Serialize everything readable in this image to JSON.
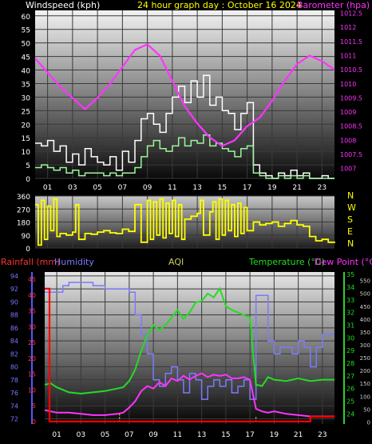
{
  "chart_data": [
    {
      "type": "line",
      "panel": "wind-barometer",
      "title": "24 hour graph day : October 16 2024",
      "left_label": "Windspeed (kph)",
      "right_label": "Barometer (hpa)",
      "x_ticks": [
        "01",
        "03",
        "05",
        "07",
        "09",
        "11",
        "13",
        "15",
        "17",
        "19",
        "21",
        "23"
      ],
      "y_left_ticks": [
        "0",
        "5",
        "10",
        "15",
        "20",
        "25",
        "30",
        "35",
        "40",
        "45",
        "50",
        "55",
        "60"
      ],
      "y_left_range": [
        0,
        62
      ],
      "y_right_ticks": [
        "1007",
        "1007.5",
        "1008",
        "1008.5",
        "1009",
        "1009.5",
        "1010",
        "1010.5",
        "1011",
        "1011.5",
        "1012",
        "1012.5"
      ],
      "y_right_range": [
        1006.65,
        1012.6
      ],
      "series": [
        {
          "name": "Windspeed gust",
          "color": "#ffffff",
          "x": [
            0,
            0.5,
            1,
            1.5,
            2,
            2.5,
            3,
            3.5,
            4,
            4.5,
            5,
            5.5,
            6,
            6.5,
            7,
            7.5,
            8,
            8.5,
            9,
            9.5,
            10,
            10.5,
            11,
            11.5,
            12,
            12.5,
            13,
            13.5,
            14,
            14.5,
            15,
            15.5,
            16,
            16.5,
            17,
            17.5,
            18,
            18.5,
            19,
            19.5,
            20,
            20.5,
            21,
            21.5,
            22,
            22.5,
            23,
            23.5,
            24
          ],
          "values": [
            13,
            12,
            14,
            10,
            12,
            6,
            9,
            5,
            11,
            8,
            6,
            5,
            8,
            3,
            10,
            6,
            14,
            22,
            24,
            20,
            17,
            24,
            30,
            34,
            28,
            36,
            30,
            38,
            27,
            30,
            25,
            24,
            18,
            24,
            28,
            5,
            2,
            1,
            0,
            2,
            1,
            3,
            1,
            2,
            0,
            0,
            1,
            0,
            0
          ]
        },
        {
          "name": "Windspeed average",
          "color": "#9cf59c",
          "x": [
            0,
            0.5,
            1,
            1.5,
            2,
            2.5,
            3,
            3.5,
            4,
            4.5,
            5,
            5.5,
            6,
            6.5,
            7,
            7.5,
            8,
            8.5,
            9,
            9.5,
            10,
            10.5,
            11,
            11.5,
            12,
            12.5,
            13,
            13.5,
            14,
            14.5,
            15,
            15.5,
            16,
            16.5,
            17,
            17.5,
            18,
            18.5,
            19,
            19.5,
            20,
            20.5,
            21,
            21.5,
            22,
            22.5,
            23,
            23.5,
            24
          ],
          "values": [
            4,
            5,
            4,
            3,
            4,
            2,
            3,
            1,
            2,
            2,
            2,
            1,
            2,
            1,
            2,
            2,
            4,
            8,
            12,
            14,
            11,
            10,
            12,
            15,
            12,
            14,
            13,
            16,
            12,
            13,
            11,
            10,
            8,
            11,
            12,
            2,
            1,
            0,
            0,
            1,
            0,
            1,
            0,
            1,
            0,
            0,
            0,
            0,
            0
          ]
        },
        {
          "name": "Barometer",
          "color": "#ff33ff",
          "x": [
            0,
            1,
            2,
            3,
            4,
            5,
            6,
            7,
            8,
            9,
            10,
            11,
            12,
            13,
            14,
            15,
            16,
            17,
            18,
            19,
            20,
            21,
            22,
            23,
            24
          ],
          "values": [
            1010.9,
            1010.4,
            1009.9,
            1009.5,
            1009.1,
            1009.5,
            1010.0,
            1010.6,
            1011.2,
            1011.4,
            1011.0,
            1010.1,
            1009.2,
            1008.6,
            1008.1,
            1007.8,
            1008.0,
            1008.5,
            1008.8,
            1009.4,
            1010.1,
            1010.7,
            1011.0,
            1010.8,
            1010.5
          ]
        }
      ]
    },
    {
      "type": "line",
      "panel": "wind-direction",
      "y_left_ticks": [
        "0",
        "90",
        "180",
        "270",
        "360"
      ],
      "y_range": [
        0,
        360
      ],
      "right_labels": [
        "N",
        "W",
        "S",
        "E",
        "N"
      ],
      "series": [
        {
          "name": "Wind direction",
          "color": "#ffff00",
          "x": [
            0,
            0.25,
            0.5,
            0.75,
            1,
            1.25,
            1.5,
            1.75,
            2,
            2.5,
            3,
            3.25,
            3.5,
            4,
            4.5,
            5,
            5.5,
            6,
            6.5,
            7,
            7.5,
            8,
            8.5,
            9,
            9.25,
            9.5,
            9.75,
            10,
            10.25,
            10.5,
            10.75,
            11,
            11.25,
            11.5,
            11.75,
            12,
            12.5,
            13,
            13.25,
            13.5,
            14,
            14.25,
            14.5,
            14.75,
            15,
            15.25,
            15.5,
            15.75,
            16,
            16.25,
            16.5,
            16.75,
            17,
            17.5,
            18,
            18.5,
            19,
            19.5,
            20,
            20.5,
            21,
            21.5,
            22,
            22.5,
            23,
            23.5,
            24
          ],
          "values": [
            300,
            20,
            330,
            60,
            290,
            120,
            340,
            80,
            100,
            90,
            110,
            300,
            60,
            100,
            95,
            110,
            120,
            105,
            100,
            130,
            115,
            300,
            40,
            330,
            60,
            320,
            90,
            340,
            70,
            310,
            100,
            330,
            80,
            300,
            60,
            200,
            220,
            240,
            330,
            90,
            250,
            320,
            60,
            340,
            90,
            330,
            120,
            300,
            80,
            310,
            100,
            280,
            120,
            180,
            160,
            170,
            180,
            150,
            170,
            190,
            160,
            150,
            80,
            50,
            60,
            40,
            45
          ]
        }
      ]
    },
    {
      "type": "line",
      "panel": "rain-humidity-temperature",
      "labels": {
        "rainfall": "Rainfall (mm)",
        "humidity": "Humidity",
        "aqi": "AQI",
        "temperature": "Temperature (°C)",
        "dew_point": "Dew Point (°C)"
      },
      "y_humidity_ticks": [
        "72",
        "74",
        "76",
        "78",
        "80",
        "82",
        "84",
        "86",
        "88",
        "90",
        "92",
        "94"
      ],
      "y_humidity_range": [
        71.2,
        94.6
      ],
      "y_rain_ticks": [
        "0",
        "5",
        "10",
        "15",
        "20",
        "25",
        "30",
        "35",
        "40",
        "45"
      ],
      "y_rain_range": [
        -0.8,
        47.3
      ],
      "y_temp_ticks": [
        "24",
        "25",
        "26",
        "27",
        "28",
        "29",
        "30",
        "31",
        "32",
        "33",
        "34",
        "35"
      ],
      "y_temp_range": [
        23.2,
        35.2
      ],
      "y_aqi_ticks": [
        "0",
        "50",
        "100",
        "150",
        "200",
        "250",
        "300",
        "350",
        "400",
        "450",
        "500",
        "550"
      ],
      "y_aqi_range": [
        -8,
        583
      ],
      "series": [
        {
          "name": "Rainfall",
          "color": "#ff0000",
          "x": [
            0,
            0.4,
            0.4,
            1,
            3,
            5,
            7,
            9,
            11,
            13,
            15,
            17,
            19,
            20,
            21,
            21.5,
            22,
            22,
            23,
            24
          ],
          "values": [
            42,
            42,
            0,
            0,
            0,
            0,
            0,
            0,
            0,
            0,
            0,
            0,
            0,
            0,
            0,
            0,
            0,
            1.5,
            1.5,
            1.5
          ]
        },
        {
          "name": "Humidity",
          "color": "#7a7aff",
          "x": [
            0,
            1,
            1.5,
            2,
            3,
            4,
            5,
            6,
            7,
            7.5,
            8,
            8.5,
            9,
            9.5,
            10,
            10.5,
            11,
            11.5,
            12,
            12.5,
            13,
            13.5,
            14,
            14.5,
            15,
            15.5,
            16,
            16.5,
            17,
            17.5,
            18,
            18.5,
            19,
            19.5,
            20,
            20.5,
            21,
            21.5,
            22,
            22.5,
            23,
            23.5,
            24
          ],
          "values": [
            91.5,
            91.5,
            92.5,
            93,
            93,
            92.5,
            92,
            92,
            91.5,
            88,
            85,
            82,
            78,
            77,
            79,
            80,
            78,
            76,
            79,
            78,
            75,
            77,
            78,
            77,
            78,
            76,
            77,
            78,
            75,
            91,
            91,
            84,
            82,
            83,
            83,
            82,
            84,
            83,
            80,
            83,
            85,
            85,
            85
          ]
        },
        {
          "name": "AQI",
          "color": "#ffff66",
          "x": [
            6.2,
            6.2,
            17.5,
            17.5
          ],
          "values": [
            0,
            30,
            0,
            25
          ]
        },
        {
          "name": "Temperature",
          "color": "#22dd22",
          "x": [
            0,
            0.5,
            1,
            2,
            3,
            4,
            5,
            6,
            6.5,
            7,
            7.5,
            8,
            8.5,
            9,
            9.5,
            10,
            10.5,
            11,
            11.5,
            12,
            12.5,
            13,
            13.5,
            14,
            14.5,
            15,
            15.5,
            16,
            16.5,
            17,
            17.5,
            18,
            18.5,
            19,
            20,
            21,
            22,
            23,
            24
          ],
          "values": [
            26.3,
            26.4,
            26.1,
            25.7,
            25.6,
            25.7,
            25.8,
            26.0,
            26.1,
            26.6,
            27.5,
            29.0,
            30.2,
            31.0,
            30.6,
            31.0,
            31.6,
            32.2,
            31.5,
            32.0,
            32.8,
            32.9,
            33.5,
            33.2,
            33.9,
            32.5,
            32.2,
            32.0,
            31.8,
            31.6,
            26.3,
            26.2,
            26.9,
            26.7,
            26.6,
            26.8,
            26.6,
            26.7,
            26.7
          ]
        },
        {
          "name": "Dew Point",
          "color": "#ff33ff",
          "x": [
            0,
            0.5,
            1,
            2,
            3,
            4,
            5,
            6,
            6.5,
            7,
            7.5,
            8,
            8.5,
            9,
            9.5,
            10,
            10.5,
            11,
            11.5,
            12,
            12.5,
            13,
            13.5,
            14,
            14.5,
            15,
            15.5,
            16,
            16.5,
            17,
            17.5,
            18,
            18.5,
            19,
            20,
            21,
            22,
            23,
            24
          ],
          "values": [
            24.3,
            24.2,
            24.1,
            24.1,
            24.0,
            23.9,
            23.9,
            24.0,
            24.1,
            24.5,
            25.0,
            25.8,
            26.2,
            26.0,
            26.5,
            26.2,
            26.8,
            26.6,
            27.0,
            26.7,
            27.0,
            27.2,
            26.9,
            27.1,
            27.0,
            27.1,
            26.8,
            26.8,
            26.9,
            26.7,
            24.4,
            24.2,
            24.1,
            24.2,
            24.0,
            23.9,
            23.8,
            23.8,
            23.8
          ]
        }
      ]
    }
  ]
}
